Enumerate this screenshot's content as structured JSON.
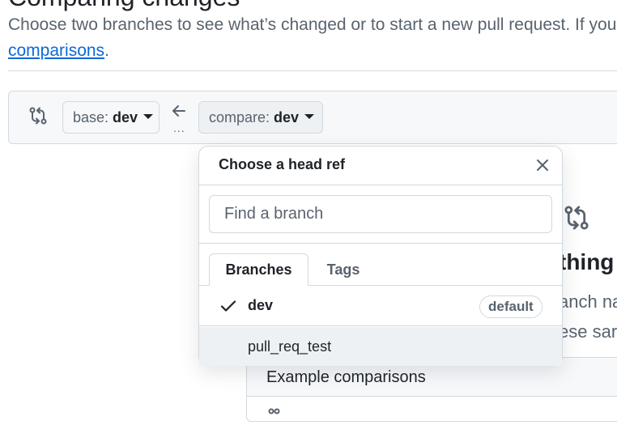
{
  "page": {
    "heading_fragment": "Comparing changes",
    "description_text": "Choose two branches to see what’s changed or to start a new pull request. If you",
    "description_link": "comparisons",
    "description_end": "."
  },
  "range_editor": {
    "base_prefix": "base:",
    "base_value": "dev",
    "compare_prefix": "compare:",
    "compare_value": "dev",
    "ellipsis": "..."
  },
  "background": {
    "blank_title": "thing",
    "blank_line1": "anch na",
    "blank_line2": "ese sar",
    "example_title": "Example comparisons"
  },
  "popover": {
    "title": "Choose a head ref",
    "search_placeholder": "Find a branch",
    "tabs": [
      {
        "label": "Branches",
        "selected": true
      },
      {
        "label": "Tags",
        "selected": false
      }
    ],
    "branches": [
      {
        "name": "dev",
        "selected": true,
        "badge": "default"
      },
      {
        "name": "pull_req_test",
        "selected": false,
        "badge": ""
      }
    ]
  },
  "colors": {
    "accent": "#0969da",
    "border": "#d1d9e0",
    "muted_text": "#59636e",
    "hover_row": "#eef1f4"
  },
  "icons": [
    "git-compare-icon",
    "arrow-left-icon",
    "close-icon",
    "check-icon",
    "git-commit-icon"
  ]
}
